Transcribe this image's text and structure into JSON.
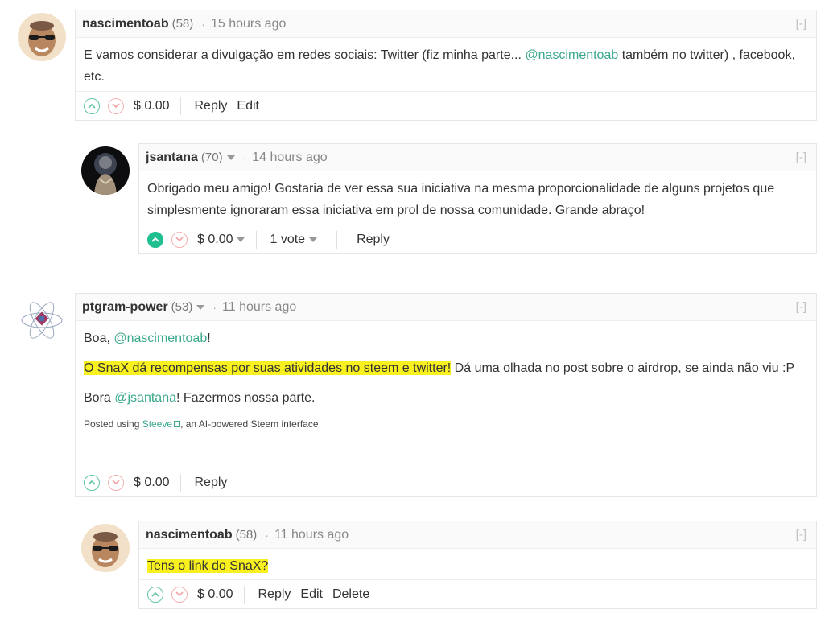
{
  "comments": [
    {
      "author": "nascimentoab",
      "reputation": "(58)",
      "time": "15 hours ago",
      "collapse": "[-]",
      "body_text_1": "E vamos considerar a divulgação em redes sociais: Twitter (fiz minha parte... ",
      "mention": "@nascimentoab",
      "body_text_2": " também no twitter) , facebook, etc.",
      "payout": "$ 0.00",
      "actions": [
        "Reply",
        "Edit"
      ]
    },
    {
      "author": "jsantana",
      "reputation": "(70)",
      "time": "14 hours ago",
      "collapse": "[-]",
      "body_text": "Obrigado meu amigo! Gostaria de ver essa sua iniciativa na mesma proporcionalidade de alguns projetos que simplesmente ignoraram essa iniciativa em prol de nossa comunidade. Grande abraço!",
      "payout": "$ 0.00",
      "votes": "1 vote",
      "actions": [
        "Reply"
      ]
    },
    {
      "author": "ptgram-power",
      "reputation": "(53)",
      "time": "11 hours ago",
      "collapse": "[-]",
      "p1_text": "Boa, ",
      "p1_mention": "@nascimentoab",
      "p1_end": "!",
      "p2_highlight": "O SnaX dá recompensas por suas atividades no steem e twitter!",
      "p2_rest": " Dá uma olhada no post sobre o airdrop, se ainda não viu :P",
      "p3_text": "Bora ",
      "p3_mention": "@jsantana",
      "p3_end": "! Fazermos nossa parte.",
      "posted_prefix": "Posted using ",
      "posted_link": "Steeve",
      "posted_suffix": ", an AI-powered Steem interface",
      "payout": "$ 0.00",
      "actions": [
        "Reply"
      ]
    },
    {
      "author": "nascimentoab",
      "reputation": "(58)",
      "time": "11 hours ago",
      "collapse": "[-]",
      "body_highlight": "Tens o link do SnaX?",
      "payout": "$ 0.00",
      "actions": [
        "Reply",
        "Edit",
        "Delete"
      ]
    }
  ],
  "separator": "·",
  "colors": {
    "link": "#3aa88d",
    "highlight": "#f9f11f",
    "upvote_active": "#1fbf8f"
  },
  "icons": [
    "upvote-icon",
    "downvote-icon",
    "dropdown-caret-icon",
    "external-link-icon"
  ]
}
